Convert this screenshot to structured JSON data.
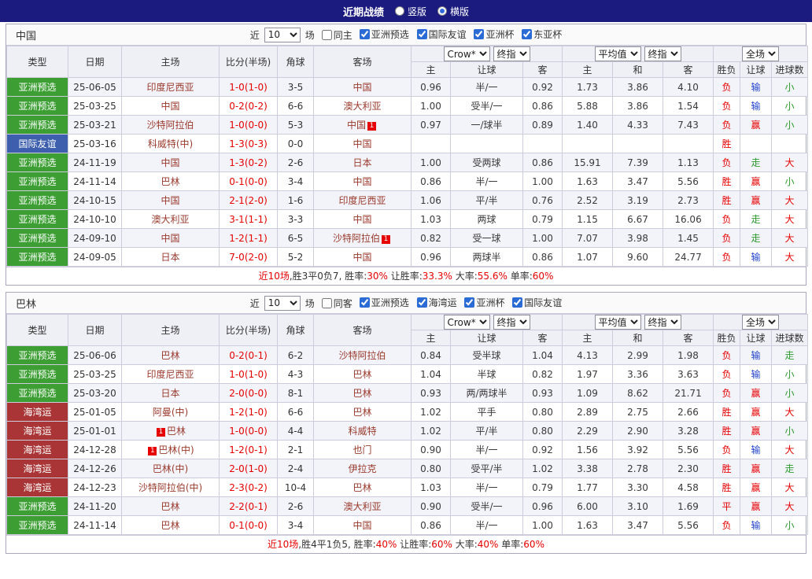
{
  "topbar": {
    "title": "近期战绩",
    "radios": [
      {
        "label": "竖版",
        "selected": false
      },
      {
        "label": "横版",
        "selected": true
      }
    ]
  },
  "columns": {
    "main": [
      "类型",
      "日期",
      "主场",
      "比分(半场)",
      "角球",
      "客场"
    ],
    "sub": [
      "主",
      "让球",
      "客",
      "主",
      "和",
      "客",
      "胜负",
      "让球",
      "进球数"
    ]
  },
  "colors": {
    "topbar_bg": "#1a1a7f",
    "badge_green": "#3c9e33",
    "badge_blue": "#3d5fae",
    "badge_red": "#aa3536",
    "team_link": "#9a3a2c",
    "win_red": "#e60000",
    "lose_blue": "#2244cc",
    "push_green": "#2e9b2e"
  },
  "sections": [
    {
      "team": "中国",
      "filter": {
        "near": "近",
        "count": "10",
        "games": "场",
        "same": {
          "label": "同主",
          "checked": false
        },
        "comps": [
          {
            "label": "亚洲预选",
            "checked": true
          },
          {
            "label": "国际友谊",
            "checked": true
          },
          {
            "label": "亚洲杯",
            "checked": true
          },
          {
            "label": "东亚杯",
            "checked": true
          }
        ]
      },
      "selects": {
        "asia1": "Crow*",
        "asia2": "终指",
        "euro1": "平均值",
        "euro2": "终指",
        "full": "全场"
      },
      "rows": [
        {
          "type": "亚洲预选",
          "tc": "green",
          "date": "25-06-05",
          "home": {
            "name": "印度尼西亚"
          },
          "score": "1-0(1-0)",
          "corner": "3-5",
          "away": {
            "name": "中国"
          },
          "odds": [
            "0.96",
            "半/一",
            "0.92",
            "1.73",
            "3.86",
            "4.10"
          ],
          "res": [
            "负",
            "red"
          ],
          "hcp": [
            "输",
            "blue"
          ],
          "gl": [
            "小",
            "green"
          ]
        },
        {
          "type": "亚洲预选",
          "tc": "green",
          "date": "25-03-25",
          "home": {
            "name": "中国"
          },
          "score": "0-2(0-2)",
          "corner": "6-6",
          "away": {
            "name": "澳大利亚"
          },
          "odds": [
            "1.00",
            "受半/一",
            "0.86",
            "5.88",
            "3.86",
            "1.54"
          ],
          "res": [
            "负",
            "red"
          ],
          "hcp": [
            "输",
            "blue"
          ],
          "gl": [
            "小",
            "green"
          ]
        },
        {
          "type": "亚洲预选",
          "tc": "green",
          "date": "25-03-21",
          "home": {
            "name": "沙特阿拉伯"
          },
          "score": "1-0(0-0)",
          "corner": "5-3",
          "away": {
            "name": "中国",
            "post": "1"
          },
          "odds": [
            "0.97",
            "一/球半",
            "0.89",
            "1.40",
            "4.33",
            "7.43"
          ],
          "res": [
            "负",
            "red"
          ],
          "hcp": [
            "赢",
            "red"
          ],
          "gl": [
            "小",
            "green"
          ]
        },
        {
          "type": "国际友谊",
          "tc": "blue",
          "date": "25-03-16",
          "home": {
            "name": "科威特(中)"
          },
          "score": "1-3(0-3)",
          "corner": "0-0",
          "away": {
            "name": "中国"
          },
          "odds": [
            "",
            "",
            "",
            "",
            "",
            ""
          ],
          "res": [
            "胜",
            "red"
          ],
          "hcp": [
            "",
            ""
          ],
          "gl": [
            "",
            ""
          ]
        },
        {
          "type": "亚洲预选",
          "tc": "green",
          "date": "24-11-19",
          "home": {
            "name": "中国"
          },
          "score": "1-3(0-2)",
          "corner": "2-6",
          "away": {
            "name": "日本"
          },
          "odds": [
            "1.00",
            "受两球",
            "0.86",
            "15.91",
            "7.39",
            "1.13"
          ],
          "res": [
            "负",
            "red"
          ],
          "hcp": [
            "走",
            "green"
          ],
          "gl": [
            "大",
            "red"
          ]
        },
        {
          "type": "亚洲预选",
          "tc": "green",
          "date": "24-11-14",
          "home": {
            "name": "巴林"
          },
          "score": "0-1(0-0)",
          "corner": "3-4",
          "away": {
            "name": "中国"
          },
          "odds": [
            "0.86",
            "半/一",
            "1.00",
            "1.63",
            "3.47",
            "5.56"
          ],
          "res": [
            "胜",
            "red"
          ],
          "hcp": [
            "赢",
            "red"
          ],
          "gl": [
            "小",
            "green"
          ]
        },
        {
          "type": "亚洲预选",
          "tc": "green",
          "date": "24-10-15",
          "home": {
            "name": "中国"
          },
          "score": "2-1(2-0)",
          "corner": "1-6",
          "away": {
            "name": "印度尼西亚"
          },
          "odds": [
            "1.06",
            "平/半",
            "0.76",
            "2.52",
            "3.19",
            "2.73"
          ],
          "res": [
            "胜",
            "red"
          ],
          "hcp": [
            "赢",
            "red"
          ],
          "gl": [
            "大",
            "red"
          ]
        },
        {
          "type": "亚洲预选",
          "tc": "green",
          "date": "24-10-10",
          "home": {
            "name": "澳大利亚"
          },
          "score": "3-1(1-1)",
          "corner": "3-3",
          "away": {
            "name": "中国"
          },
          "odds": [
            "1.03",
            "两球",
            "0.79",
            "1.15",
            "6.67",
            "16.06"
          ],
          "res": [
            "负",
            "red"
          ],
          "hcp": [
            "走",
            "green"
          ],
          "gl": [
            "大",
            "red"
          ]
        },
        {
          "type": "亚洲预选",
          "tc": "green",
          "date": "24-09-10",
          "home": {
            "name": "中国"
          },
          "score": "1-2(1-1)",
          "corner": "6-5",
          "away": {
            "name": "沙特阿拉伯",
            "post": "1"
          },
          "odds": [
            "0.82",
            "受一球",
            "1.00",
            "7.07",
            "3.98",
            "1.45"
          ],
          "res": [
            "负",
            "red"
          ],
          "hcp": [
            "走",
            "green"
          ],
          "gl": [
            "大",
            "red"
          ]
        },
        {
          "type": "亚洲预选",
          "tc": "green",
          "date": "24-09-05",
          "home": {
            "name": "日本"
          },
          "score": "7-0(2-0)",
          "corner": "5-2",
          "away": {
            "name": "中国"
          },
          "odds": [
            "0.96",
            "两球半",
            "0.86",
            "1.07",
            "9.60",
            "24.77"
          ],
          "res": [
            "负",
            "red"
          ],
          "hcp": [
            "输",
            "blue"
          ],
          "gl": [
            "大",
            "red"
          ]
        }
      ],
      "summary": [
        [
          "近10场",
          "red"
        ],
        [
          ",胜3平0负7, 胜率:",
          "dark"
        ],
        [
          "30%",
          "red"
        ],
        [
          " 让胜率:",
          "dark"
        ],
        [
          "33.3%",
          "red"
        ],
        [
          " 大率:",
          "dark"
        ],
        [
          "55.6%",
          "red"
        ],
        [
          " 单率:",
          "dark"
        ],
        [
          "60%",
          "red"
        ]
      ]
    },
    {
      "team": "巴林",
      "filter": {
        "near": "近",
        "count": "10",
        "games": "场",
        "same": {
          "label": "同客",
          "checked": false
        },
        "comps": [
          {
            "label": "亚洲预选",
            "checked": true
          },
          {
            "label": "海湾运",
            "checked": true
          },
          {
            "label": "亚洲杯",
            "checked": true
          },
          {
            "label": "国际友谊",
            "checked": true
          }
        ]
      },
      "selects": {
        "asia1": "Crow*",
        "asia2": "终指",
        "euro1": "平均值",
        "euro2": "终指",
        "full": "全场"
      },
      "rows": [
        {
          "type": "亚洲预选",
          "tc": "green",
          "date": "25-06-06",
          "home": {
            "name": "巴林"
          },
          "score": "0-2(0-1)",
          "corner": "6-2",
          "away": {
            "name": "沙特阿拉伯"
          },
          "odds": [
            "0.84",
            "受半球",
            "1.04",
            "4.13",
            "2.99",
            "1.98"
          ],
          "res": [
            "负",
            "red"
          ],
          "hcp": [
            "输",
            "blue"
          ],
          "gl": [
            "走",
            "green"
          ]
        },
        {
          "type": "亚洲预选",
          "tc": "green",
          "date": "25-03-25",
          "home": {
            "name": "印度尼西亚"
          },
          "score": "1-0(1-0)",
          "corner": "4-3",
          "away": {
            "name": "巴林"
          },
          "odds": [
            "1.04",
            "半球",
            "0.82",
            "1.97",
            "3.36",
            "3.63"
          ],
          "res": [
            "负",
            "red"
          ],
          "hcp": [
            "输",
            "blue"
          ],
          "gl": [
            "小",
            "green"
          ]
        },
        {
          "type": "亚洲预选",
          "tc": "green",
          "date": "25-03-20",
          "home": {
            "name": "日本"
          },
          "score": "2-0(0-0)",
          "corner": "8-1",
          "away": {
            "name": "巴林"
          },
          "odds": [
            "0.93",
            "两/两球半",
            "0.93",
            "1.09",
            "8.62",
            "21.71"
          ],
          "res": [
            "负",
            "red"
          ],
          "hcp": [
            "赢",
            "red"
          ],
          "gl": [
            "小",
            "green"
          ]
        },
        {
          "type": "海湾运",
          "tc": "red",
          "date": "25-01-05",
          "home": {
            "name": "阿曼(中)"
          },
          "score": "1-2(1-0)",
          "corner": "6-6",
          "away": {
            "name": "巴林"
          },
          "odds": [
            "1.02",
            "平手",
            "0.80",
            "2.89",
            "2.75",
            "2.66"
          ],
          "res": [
            "胜",
            "red"
          ],
          "hcp": [
            "赢",
            "red"
          ],
          "gl": [
            "大",
            "red"
          ]
        },
        {
          "type": "海湾运",
          "tc": "red",
          "date": "25-01-01",
          "home": {
            "name": "巴林",
            "pre": "1"
          },
          "score": "1-0(0-0)",
          "corner": "4-4",
          "away": {
            "name": "科威特"
          },
          "odds": [
            "1.02",
            "平/半",
            "0.80",
            "2.29",
            "2.90",
            "3.28"
          ],
          "res": [
            "胜",
            "red"
          ],
          "hcp": [
            "赢",
            "red"
          ],
          "gl": [
            "小",
            "green"
          ]
        },
        {
          "type": "海湾运",
          "tc": "red",
          "date": "24-12-28",
          "home": {
            "name": "巴林(中)",
            "pre": "1"
          },
          "score": "1-2(0-1)",
          "corner": "2-1",
          "away": {
            "name": "也门"
          },
          "odds": [
            "0.90",
            "半/一",
            "0.92",
            "1.56",
            "3.92",
            "5.56"
          ],
          "res": [
            "负",
            "red"
          ],
          "hcp": [
            "输",
            "blue"
          ],
          "gl": [
            "大",
            "red"
          ]
        },
        {
          "type": "海湾运",
          "tc": "red",
          "date": "24-12-26",
          "home": {
            "name": "巴林(中)"
          },
          "score": "2-0(1-0)",
          "corner": "2-4",
          "away": {
            "name": "伊拉克"
          },
          "odds": [
            "0.80",
            "受平/半",
            "1.02",
            "3.38",
            "2.78",
            "2.30"
          ],
          "res": [
            "胜",
            "red"
          ],
          "hcp": [
            "赢",
            "red"
          ],
          "gl": [
            "走",
            "green"
          ]
        },
        {
          "type": "海湾运",
          "tc": "red",
          "date": "24-12-23",
          "home": {
            "name": "沙特阿拉伯(中)"
          },
          "score": "2-3(0-2)",
          "corner": "10-4",
          "away": {
            "name": "巴林"
          },
          "odds": [
            "1.03",
            "半/一",
            "0.79",
            "1.77",
            "3.30",
            "4.58"
          ],
          "res": [
            "胜",
            "red"
          ],
          "hcp": [
            "赢",
            "red"
          ],
          "gl": [
            "大",
            "red"
          ]
        },
        {
          "type": "亚洲预选",
          "tc": "green",
          "date": "24-11-20",
          "home": {
            "name": "巴林"
          },
          "score": "2-2(0-1)",
          "corner": "2-6",
          "away": {
            "name": "澳大利亚"
          },
          "odds": [
            "0.90",
            "受半/一",
            "0.96",
            "6.00",
            "3.10",
            "1.69"
          ],
          "res": [
            "平",
            "red"
          ],
          "hcp": [
            "赢",
            "red"
          ],
          "gl": [
            "大",
            "red"
          ]
        },
        {
          "type": "亚洲预选",
          "tc": "green",
          "date": "24-11-14",
          "home": {
            "name": "巴林"
          },
          "score": "0-1(0-0)",
          "corner": "3-4",
          "away": {
            "name": "中国"
          },
          "odds": [
            "0.86",
            "半/一",
            "1.00",
            "1.63",
            "3.47",
            "5.56"
          ],
          "res": [
            "负",
            "red"
          ],
          "hcp": [
            "输",
            "blue"
          ],
          "gl": [
            "小",
            "green"
          ]
        }
      ],
      "summary": [
        [
          "近10场",
          "red"
        ],
        [
          ",胜4平1负5, 胜率:",
          "dark"
        ],
        [
          "40%",
          "red"
        ],
        [
          " 让胜率:",
          "dark"
        ],
        [
          "60%",
          "red"
        ],
        [
          " 大率:",
          "dark"
        ],
        [
          "40%",
          "red"
        ],
        [
          " 单率:",
          "dark"
        ],
        [
          "60%",
          "red"
        ]
      ]
    }
  ]
}
